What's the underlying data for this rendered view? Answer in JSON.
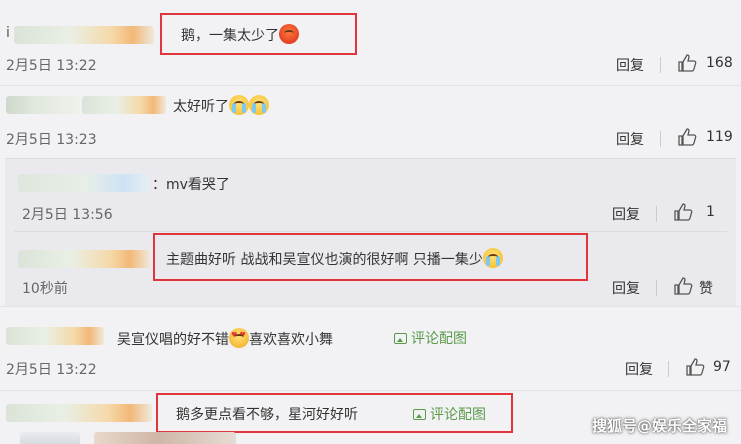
{
  "comments": [
    {
      "username_fragment": "i",
      "text": "鹅，一集太少了",
      "emoji": "angry-face-emoji",
      "time": "2月5日 13:22",
      "reply_label": "回复",
      "likes": "168"
    },
    {
      "text": "太好听了",
      "emoji": "crying-face-emoji",
      "time": "2月5日 13:23",
      "reply_label": "回复",
      "likes": "119"
    },
    {
      "text": "：mv看哭了",
      "time": "2月5日 13:56",
      "reply_label": "回复",
      "likes": "1"
    },
    {
      "text": "主题曲好听 战战和吴宣仪也演的很好啊 只播一集少",
      "emoji": "crying-face-emoji",
      "time": "10秒前",
      "reply_label": "回复",
      "like_label": "赞"
    },
    {
      "text_before": "吴宣仪唱的好不错",
      "emoji": "heart-eyes-emoji",
      "text_after": "喜欢喜欢小舞",
      "ref_label": "评论配图",
      "time": "2月5日 13:22",
      "reply_label": "回复",
      "likes": "97"
    },
    {
      "text": "鹅多更点看不够，星河好好听",
      "ref_label": "评论配图"
    }
  ],
  "watermark": "搜狐号@娱乐全家福",
  "icons": {
    "like": "thumbs-up-icon",
    "image": "image-icon"
  },
  "colors": {
    "highlight_border": "#e0353a",
    "link_green": "#5a9b49",
    "background": "#f2f2f5"
  }
}
